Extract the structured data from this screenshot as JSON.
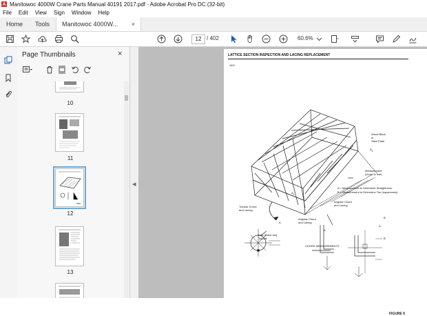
{
  "window": {
    "title": "Manitowoc 4000W Crane Parts Manual 40191 2017.pdf - Adobe Acrobat Pro DC (32-bit)"
  },
  "menu": [
    "File",
    "Edit",
    "View",
    "Sign",
    "Window",
    "Help"
  ],
  "tabs": {
    "home": "Home",
    "tools": "Tools",
    "document": "Manitowoc 4000W...",
    "close_glyph": "×"
  },
  "toolbar": {
    "current_page": "12",
    "total_pages": "/ 402",
    "zoom": "60.6%"
  },
  "thumbnails_panel": {
    "title": "Page Thumbnails",
    "close_glyph": "×",
    "pages": [
      {
        "label": "10"
      },
      {
        "label": "11"
      },
      {
        "label": "12",
        "selected": true
      },
      {
        "label": "13"
      }
    ]
  },
  "document": {
    "heading": "LATTICE SECTION INSPECTION AND LACING REPLACEMENT",
    "note": "4825",
    "labels": {
      "wood_block": "Wood Block\nor\nSteel Plate",
      "a2": "A",
      "sub2": "2",
      "measurement": "Measurement\n(chord to line)",
      "line": "Line",
      "a1": "A",
      "sub1": "1",
      "legend_a": "A = Measurement to Determine Straightness",
      "legend_b": "B = Measurement to Determine Toe (squareness)",
      "tubular": "Tubular Chord\nand Lacing",
      "angular_top": "Angular Chord\nand Lacing",
      "angular_mid": "Angular Chord\nand Lacing",
      "line_black": "Line (black dot)\nTypical",
      "chord_meas": "CHORD MEASUREMENTS",
      "a_letter": "A",
      "b_letter": "B",
      "figure": "FIGURE 6"
    }
  }
}
